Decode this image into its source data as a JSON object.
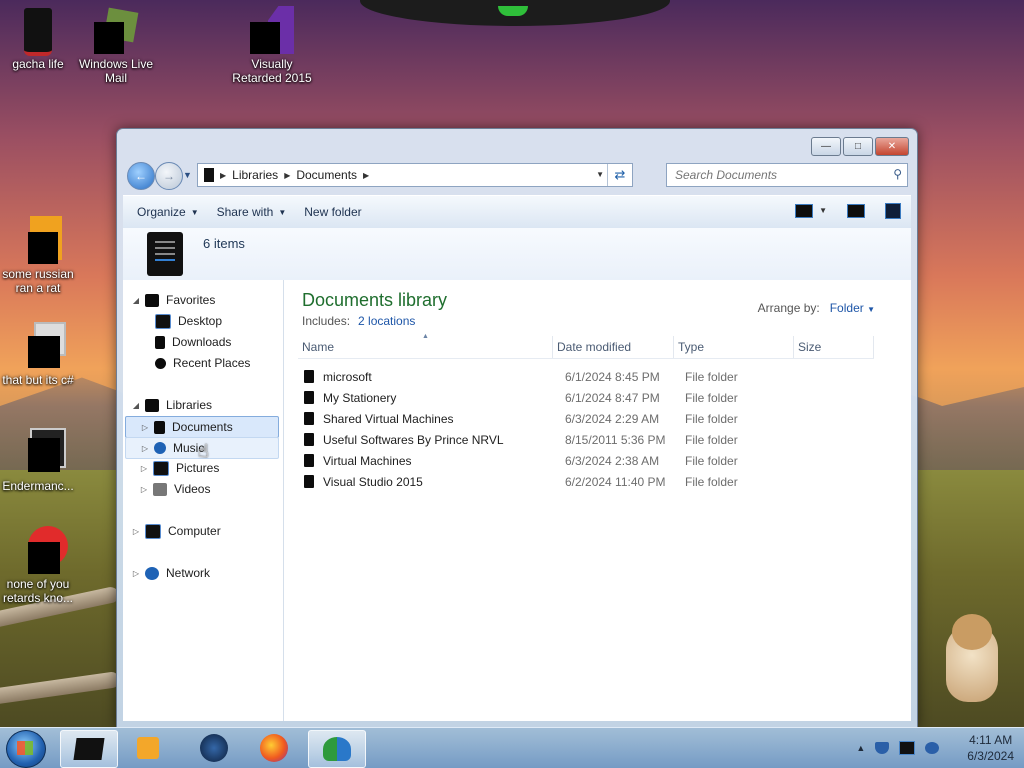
{
  "desktop": {
    "icons": [
      {
        "label": "gacha life"
      },
      {
        "label": "Windows Live\nMail"
      },
      {
        "label": "Visually\nRetarded 2015"
      },
      {
        "label": "some russian\nran a rat"
      },
      {
        "label": "that but its c#"
      },
      {
        "label": "Endermanc..."
      },
      {
        "label": "none of you\nretards kno..."
      }
    ]
  },
  "window": {
    "address": {
      "segments": [
        "Libraries",
        "Documents"
      ]
    },
    "search_placeholder": "Search Documents",
    "toolbar": {
      "organize": "Organize",
      "share_with": "Share with",
      "new_folder": "New folder"
    },
    "details": {
      "item_count": "6 items"
    },
    "nav": {
      "favorites": "Favorites",
      "desktop": "Desktop",
      "downloads": "Downloads",
      "recent_places": "Recent Places",
      "libraries": "Libraries",
      "documents": "Documents",
      "music": "Music",
      "pictures": "Pictures",
      "videos": "Videos",
      "computer": "Computer",
      "network": "Network"
    },
    "content": {
      "title": "Documents library",
      "includes_label": "Includes:",
      "includes_link": "2 locations",
      "arrange_by_label": "Arrange by:",
      "arrange_by_value": "Folder",
      "columns": [
        "Name",
        "Date modified",
        "Type",
        "Size"
      ],
      "files": [
        {
          "name": "microsoft",
          "date": "6/1/2024 8:45 PM",
          "type": "File folder"
        },
        {
          "name": "My Stationery",
          "date": "6/1/2024 8:47 PM",
          "type": "File folder"
        },
        {
          "name": "Shared Virtual Machines",
          "date": "6/3/2024 2:29 AM",
          "type": "File folder"
        },
        {
          "name": "Useful Softwares By Prince NRVL",
          "date": "8/15/2011 5:36 PM",
          "type": "File folder"
        },
        {
          "name": "Virtual Machines",
          "date": "6/3/2024 2:38 AM",
          "type": "File folder"
        },
        {
          "name": "Visual Studio 2015",
          "date": "6/2/2024 11:40 PM",
          "type": "File folder"
        }
      ]
    }
  },
  "taskbar": {
    "time": "4:11 AM",
    "date": "6/3/2024"
  },
  "colors": {
    "library_title": "#1f6e2e",
    "link": "#1e56a8",
    "selection": "#d9e8fb"
  }
}
